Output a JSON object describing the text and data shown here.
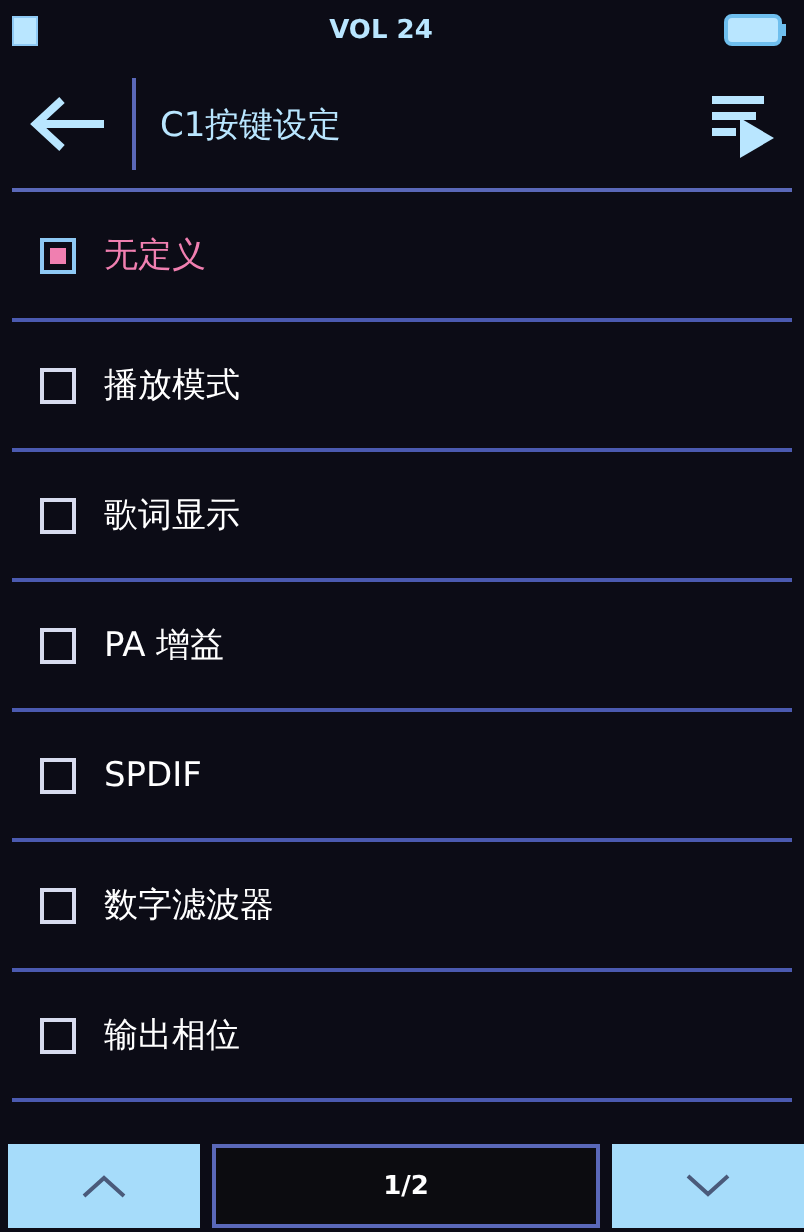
{
  "status_bar": {
    "volume": "VOL 24"
  },
  "header": {
    "title": "C1按键设定"
  },
  "options": [
    {
      "label": "无定义",
      "selected": true
    },
    {
      "label": "播放模式",
      "selected": false
    },
    {
      "label": "歌词显示",
      "selected": false
    },
    {
      "label": "PA 增益",
      "selected": false
    },
    {
      "label": "SPDIF",
      "selected": false
    },
    {
      "label": "数字滤波器",
      "selected": false
    },
    {
      "label": "输出相位",
      "selected": false
    }
  ],
  "pager": {
    "page": "1/2"
  }
}
